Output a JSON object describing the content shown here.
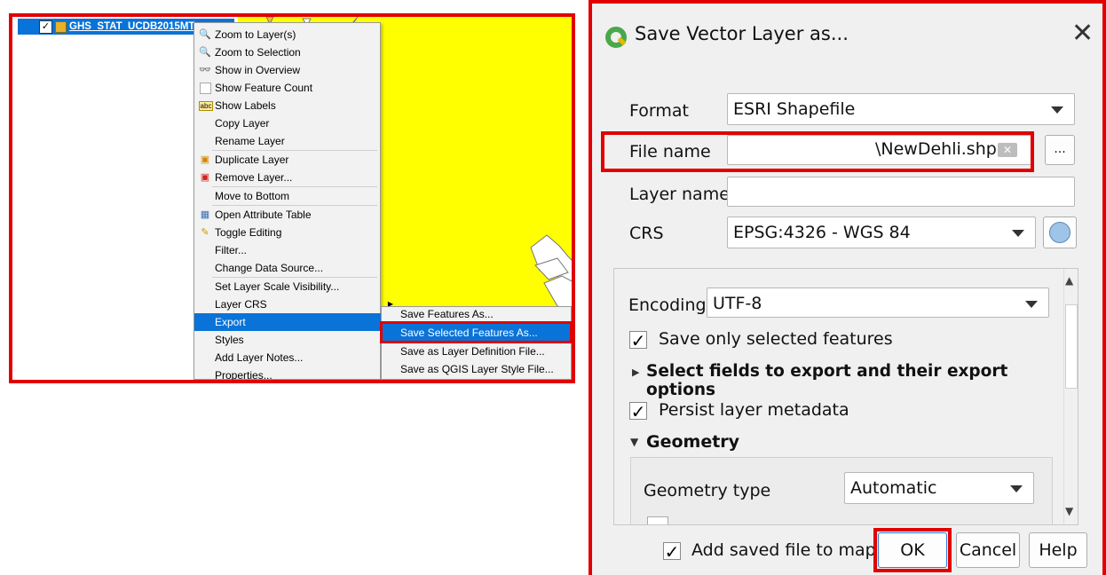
{
  "layer_panel": {
    "layer_name": "GHS_STAT_UCDB2015MT_",
    "checked": "✓",
    "swatch_color": "#e8b12a"
  },
  "context_menu": {
    "items": [
      {
        "label": "Zoom to Layer(s)",
        "icon": "zoom-layer-icon"
      },
      {
        "label": "Zoom to Selection",
        "icon": "zoom-selection-icon"
      },
      {
        "label": "Show in Overview",
        "icon": "overview-icon"
      },
      {
        "label": "Show Feature Count",
        "icon": "checkbox-icon"
      },
      {
        "label": "Show Labels",
        "icon": "labels-icon"
      },
      {
        "label": "Copy Layer",
        "icon": ""
      },
      {
        "label": "Rename Layer",
        "icon": ""
      },
      {
        "label": "Duplicate Layer",
        "icon": "duplicate-icon"
      },
      {
        "label": "Remove Layer...",
        "icon": "remove-icon"
      },
      {
        "label": "Move to Bottom",
        "icon": ""
      },
      {
        "label": "Open Attribute Table",
        "icon": "table-icon"
      },
      {
        "label": "Toggle Editing",
        "icon": "pencil-icon"
      },
      {
        "label": "Filter...",
        "icon": ""
      },
      {
        "label": "Change Data Source...",
        "icon": ""
      },
      {
        "label": "Set Layer Scale Visibility...",
        "icon": ""
      },
      {
        "label": "Layer CRS",
        "icon": ""
      },
      {
        "label": "Export",
        "icon": ""
      },
      {
        "label": "Styles",
        "icon": ""
      },
      {
        "label": "Add Layer Notes...",
        "icon": ""
      },
      {
        "label": "Properties...",
        "icon": ""
      }
    ]
  },
  "export_submenu": {
    "items": [
      {
        "label": "Save Features As..."
      },
      {
        "label": "Save Selected Features As..."
      },
      {
        "label": "Save as Layer Definition File..."
      },
      {
        "label": "Save as QGIS Layer Style File..."
      }
    ]
  },
  "dialog": {
    "title": "Save Vector Layer as...",
    "close": "✕",
    "format_label": "Format",
    "format_value": "ESRI Shapefile",
    "filename_label": "File name",
    "filename_value": "\\NewDehli.shp",
    "browse_label": "...",
    "layername_label": "Layer name",
    "layername_value": "",
    "crs_label": "CRS",
    "crs_value": "EPSG:4326 - WGS 84",
    "encoding_label": "Encoding",
    "encoding_value": "UTF-8",
    "save_selected_label": "Save only selected features",
    "select_fields_label": "Select fields to export and their export options",
    "persist_label": "Persist layer metadata",
    "geometry_label": "Geometry",
    "geometry_type_label": "Geometry type",
    "geometry_type_value": "Automatic",
    "add_saved_label": "Add saved file to map",
    "ok_label": "OK",
    "cancel_label": "Cancel",
    "help_label": "Help",
    "checkmark": "✓"
  },
  "colors": {
    "highlight_red": "#e00000",
    "selection_blue": "#0a73d8",
    "map_yellow": "#ffff00"
  }
}
